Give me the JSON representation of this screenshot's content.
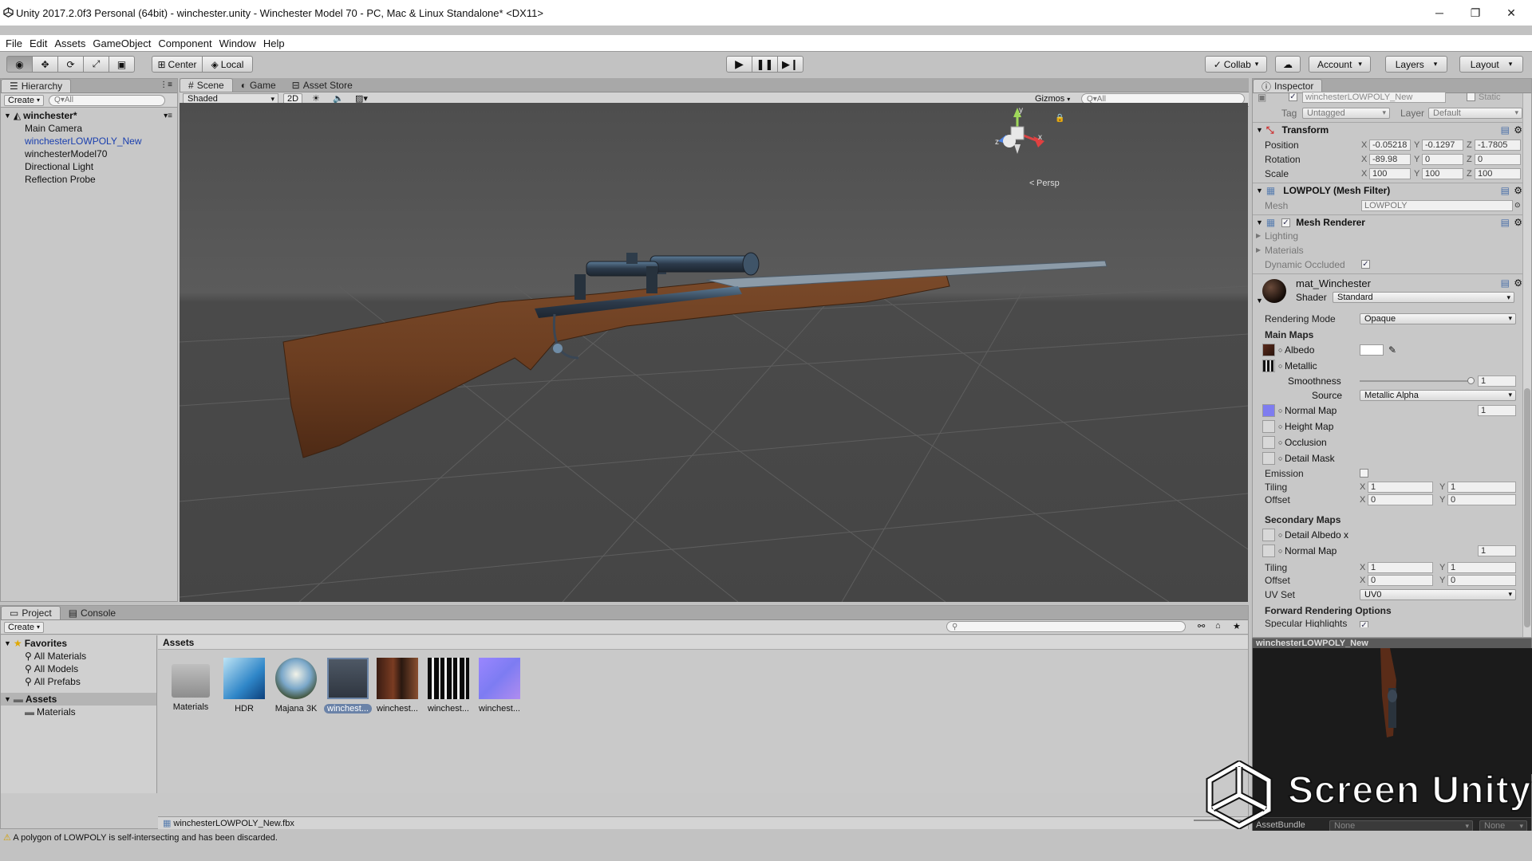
{
  "window": {
    "title": "Unity 2017.2.0f3 Personal (64bit) - winchester.unity - Winchester Model 70 - PC, Mac & Linux Standalone* <DX11>",
    "minimize": "─",
    "maximize": "❐",
    "close": "✕"
  },
  "menu": [
    "File",
    "Edit",
    "Assets",
    "GameObject",
    "Component",
    "Window",
    "Help"
  ],
  "toolbar": {
    "center": "Center",
    "local": "Local",
    "collab": "Collab",
    "account": "Account",
    "layers": "Layers",
    "layout": "Layout"
  },
  "hierarchy": {
    "tab": "Hierarchy",
    "create": "Create",
    "search_placeholder": "Q▾All",
    "scene": "winchester*",
    "items": [
      "Main Camera",
      "winchesterLOWPOLY_New",
      "winchesterModel70",
      "Directional Light",
      "Reflection Probe"
    ]
  },
  "scene_view": {
    "tabs": [
      "Scene",
      "Game",
      "Asset Store"
    ],
    "shading": "Shaded",
    "mode_2d": "2D",
    "gizmos": "Gizmos",
    "search_placeholder": "Q▾All",
    "persp": "Persp",
    "axis_y": "y",
    "axis_x": "x",
    "axis_z": "z"
  },
  "inspector": {
    "tab": "Inspector",
    "object_name": "winchesterLOWPOLY_New",
    "static": "Static",
    "tag_label": "Tag",
    "tag": "Untagged",
    "layer_label": "Layer",
    "layer": "Default",
    "transform": {
      "title": "Transform",
      "position_label": "Position",
      "rotation_label": "Rotation",
      "scale_label": "Scale",
      "position": [
        "-0.05218",
        "-0.1297",
        "-1.7805"
      ],
      "rotation": [
        "-89.98",
        "0",
        "0"
      ],
      "scale": [
        "100",
        "100",
        "100"
      ]
    },
    "mesh_filter": {
      "title": "LOWPOLY (Mesh Filter)",
      "mesh_label": "Mesh",
      "mesh": "LOWPOLY"
    },
    "mesh_renderer": {
      "title": "Mesh Renderer",
      "lighting": "Lighting",
      "materials": "Materials",
      "dynamic_occluded": "Dynamic Occluded",
      "dynamic_occluded_checked": true
    },
    "material": {
      "name": "mat_Winchester",
      "shader_label": "Shader",
      "shader": "Standard",
      "rendering_mode_label": "Rendering Mode",
      "rendering_mode": "Opaque",
      "main_maps": "Main Maps",
      "albedo": "Albedo",
      "metallic": "Metallic",
      "smoothness_label": "Smoothness",
      "smoothness": "1",
      "smoothness_fraction": 1.0,
      "source_label": "Source",
      "source": "Metallic Alpha",
      "normal_map": "Normal Map",
      "normal_map_value": "1",
      "height_map": "Height Map",
      "occlusion": "Occlusion",
      "detail_mask": "Detail Mask",
      "emission": "Emission",
      "tiling_label": "Tiling",
      "offset_label": "Offset",
      "tiling": [
        "1",
        "1"
      ],
      "offset": [
        "0",
        "0"
      ],
      "secondary_maps": "Secondary Maps",
      "detail_albedo": "Detail Albedo x",
      "normal_map_2": "Normal Map",
      "normal_map_2_value": "1",
      "tiling_2": [
        "1",
        "1"
      ],
      "offset_2": [
        "0",
        "0"
      ],
      "uv_set_label": "UV Set",
      "uv_set": "UV0",
      "forward_rendering": "Forward Rendering Options",
      "specular_highlights": "Specular Highlights"
    },
    "preview_title": "winchesterLOWPOLY_New",
    "assetbundle_label": "AssetBundle",
    "assetbundle": "None",
    "assetbundle_variant": "None"
  },
  "project": {
    "tabs": [
      "Project",
      "Console"
    ],
    "create": "Create",
    "favorites": "Favorites",
    "favorite_items": [
      "All Materials",
      "All Models",
      "All Prefabs"
    ],
    "assets_root": "Assets",
    "asset_folders": [
      "Materials"
    ],
    "breadcrumb": "Assets",
    "assets": [
      "Materials",
      "HDR",
      "Majana 3K",
      "winchest...",
      "winchest...",
      "winchest...",
      "winchest..."
    ],
    "selected_asset": "winchesterLOWPOLY_New.fbx"
  },
  "status": "A polygon of LOWPOLY is self-intersecting and has been discarded.",
  "watermark": "Screen Unity",
  "colors": {
    "selection_text": "#1a3fae",
    "scene_bg": "#515151",
    "panel_bg": "#c8c8c8",
    "normal_map_swatch": "#7e7cf0"
  }
}
